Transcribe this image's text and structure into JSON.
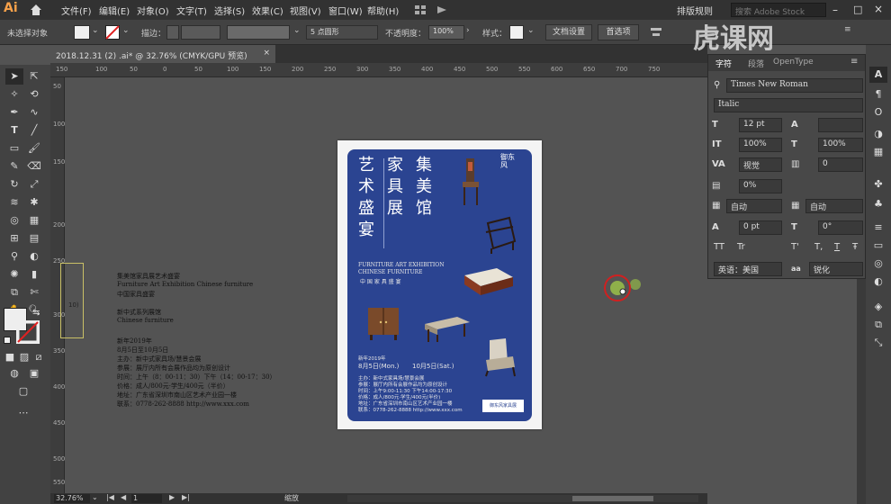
{
  "app": {
    "logo": "Ai",
    "title": "Adobe Illustrator"
  },
  "menu": {
    "items": [
      "文件(F)",
      "编辑(E)",
      "对象(O)",
      "文字(T)",
      "选择(S)",
      "效果(C)",
      "视图(V)",
      "窗口(W)",
      "帮助(H)"
    ],
    "workspace": "排版规则",
    "search_placeholder": "搜索 Adobe Stock"
  },
  "control_bar": {
    "selection": "未选择对象",
    "stroke_label": "描边：",
    "brush_label": "5 点圆形",
    "opacity_label": "不透明度：",
    "opacity_value": "100%",
    "style_label": "样式：",
    "doc_setup": "文档设置",
    "preferences": "首选项"
  },
  "document_tab": {
    "title": "2018.12.31  (2) .ai* @ 32.76% (CMYK/GPU 预览)",
    "close": "×"
  },
  "hruler": [
    "150",
    "100",
    "50",
    "0",
    "50",
    "100",
    "150",
    "200",
    "250",
    "300",
    "350",
    "400",
    "450",
    "500",
    "550",
    "600",
    "650",
    "700",
    "750"
  ],
  "vruler": [
    "50",
    "100",
    "150",
    "200",
    "250",
    "300",
    "350",
    "400",
    "450",
    "500",
    "550"
  ],
  "status": {
    "zoom": "32.76%",
    "artboard": "1",
    "mode": "缩放"
  },
  "char_panel": {
    "tabs": [
      "字符",
      "段落",
      "OpenType"
    ],
    "font_family": "Times New Roman",
    "font_style": "Italic",
    "size": "12 pt",
    "leading": "",
    "v_scale": "100%",
    "h_scale": "100%",
    "kerning": "视觉",
    "tracking": "0",
    "tsume": "0%",
    "aki_left": "自动",
    "aki_right": "自动",
    "baseline": "0 pt",
    "rotation": "0°",
    "language": "英语：美国",
    "aa": "锐化",
    "style_btns": [
      "TT",
      "Tr",
      "T'",
      "T,",
      "T",
      "Ŧ"
    ]
  },
  "poster": {
    "title_cols": [
      "集美馆",
      "家具展",
      "艺术盛宴"
    ],
    "brand": "御东风",
    "en_line1": "FURNITURE ART EXHIBITION",
    "en_line2": "CHINESE FURNITURE",
    "cn_sub": "中 国 家 具 盛 宴",
    "year_label": "新年2019年",
    "date_from": "8月5日(Mon.)",
    "date_to": "10月5日(Sat.)",
    "info": [
      "主办：新中式家具场/慧景会展",
      "参展：展厅内所有会展作品均为原创设计",
      "时间：上午9:00-11:30    下午14:00-17:30",
      "价格：成人/800元·学生/400元(半价)",
      "地址：广东省深圳市南山区艺术产业园一楼",
      "联系：0778-262-8888    http://www.xxx.com"
    ],
    "badge": "御东风家具展"
  },
  "left_text": [
    "集美馆家具展艺术盛宴",
    "Furniture Art Exhibition Chinese furniture",
    "中国家具盛宴",
    "",
    "新中式系列展馆",
    "Chinese furniture",
    "",
    "新年2019年",
    "8月5日至10月5日",
    "主办：新中式家具场/慧景会展",
    "参展：展厅内所有会展作品均为原创设计",
    "时间：上午（8：00-11：30）下午（14：00-17：30）",
    "价格：成人/800元·学生/400元（半价）",
    "地址：广东省深圳市南山区艺术产业园一楼",
    "联系：0778-262-8888 http://www.xxx.com"
  ],
  "watermark": "虎课网",
  "colors": {
    "poster_blue": "#2b4491",
    "ui_dark": "#323232",
    "ui_mid": "#424242",
    "canvas": "#535353",
    "cursor_green": "#8fb04a",
    "cursor_red": "#d02020"
  }
}
